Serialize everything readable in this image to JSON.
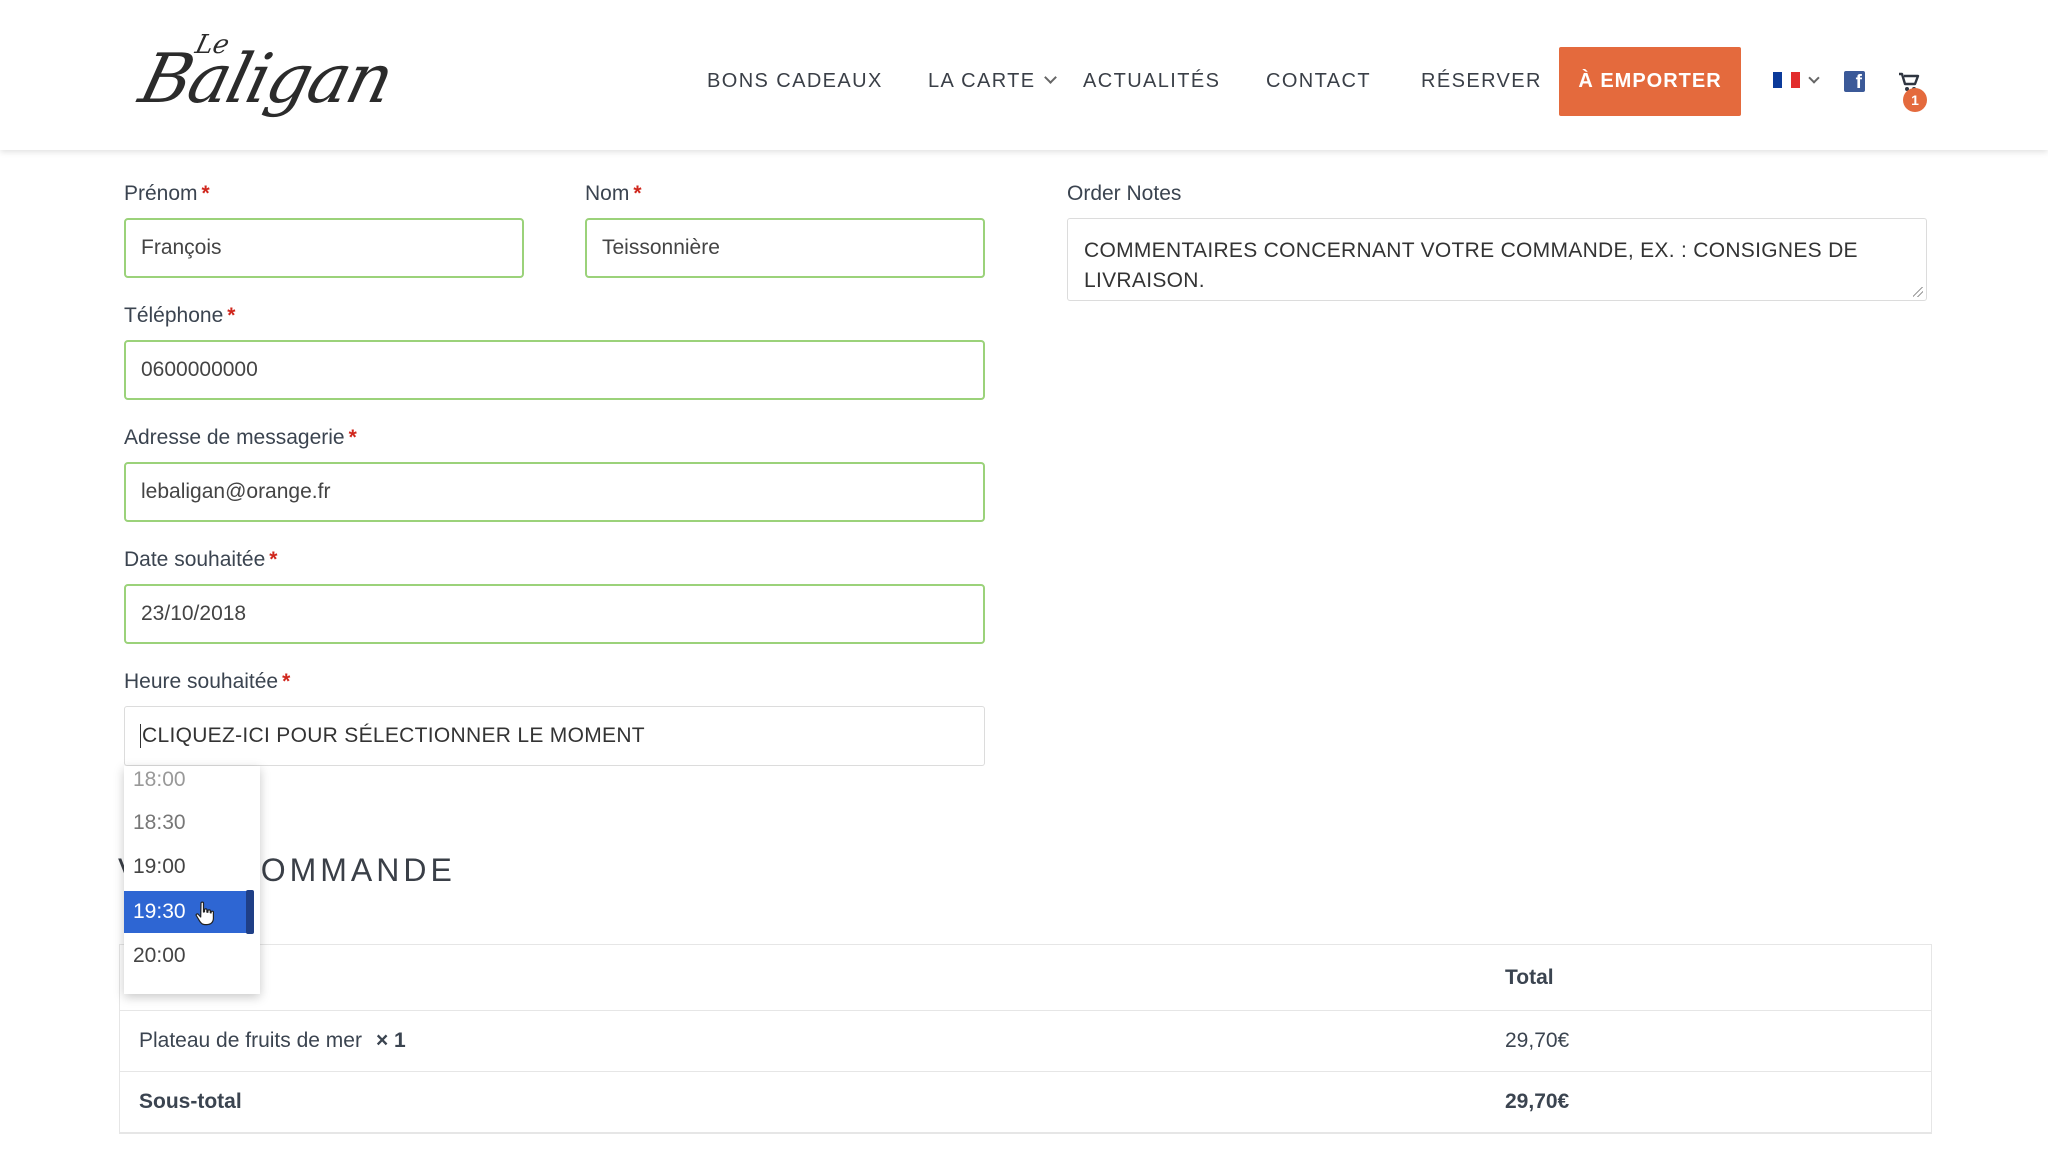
{
  "header": {
    "logo_text": "Baligan",
    "logo_small": "Le",
    "nav": {
      "bons_cadeaux": "BONS CADEAUX",
      "la_carte": "LA CARTE",
      "actualites": "ACTUALITÉS",
      "contact": "CONTACT",
      "reserver": "RÉSERVER",
      "a_emporter": "À EMPORTER"
    },
    "cart_count": "1",
    "colors": {
      "cta": "#e46a3d",
      "facebook": "#3b5998"
    }
  },
  "form": {
    "prenom": {
      "label": "Prénom",
      "required": "*",
      "value": "François"
    },
    "nom": {
      "label": "Nom",
      "required": "*",
      "value": "Teissonnière"
    },
    "telephone": {
      "label": "Téléphone",
      "required": "*",
      "value": "0600000000"
    },
    "email": {
      "label": "Adresse de messagerie",
      "required": "*",
      "value": "lebaligan@orange.fr"
    },
    "date": {
      "label": "Date souhaitée",
      "required": "*",
      "value": "23/10/2018"
    },
    "heure": {
      "label": "Heure souhaitée",
      "required": "*",
      "value": "CLIQUEZ-ICI POUR SÉLECTIONNER LE MOMENT"
    },
    "order_notes": {
      "label": "Order Notes",
      "placeholder": "COMMENTAIRES CONCERNANT VOTRE COMMANDE, EX. : CONSIGNES DE LIVRAISON."
    }
  },
  "time_dropdown": {
    "options": [
      "18:00",
      "18:30",
      "19:00",
      "19:30",
      "20:00"
    ],
    "selected": "19:30"
  },
  "order": {
    "section_title": "COMMANDE",
    "total_header": "Total",
    "items": [
      {
        "name": "Plateau de fruits de mer",
        "qty": "× 1",
        "total": "29,70€"
      }
    ],
    "subtotal_label": "Sous-total",
    "subtotal_value": "29,70€"
  }
}
